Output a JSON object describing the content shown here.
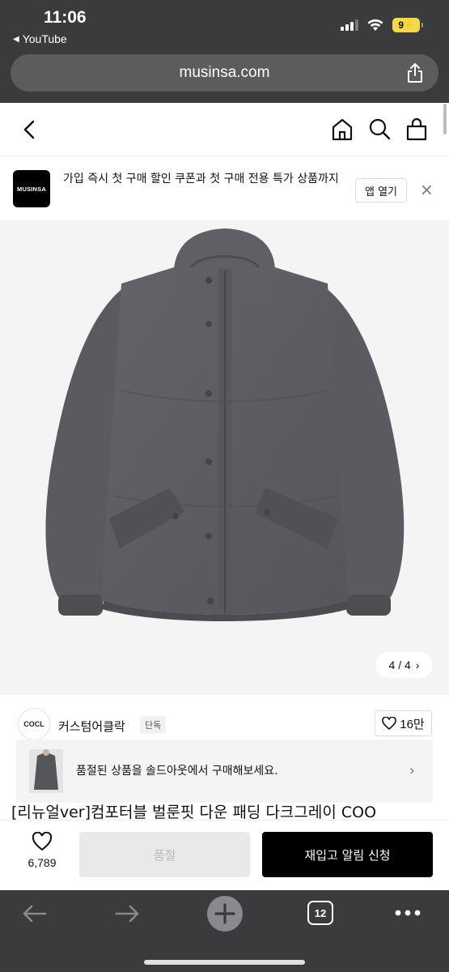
{
  "status_bar": {
    "time": "11:06",
    "back_app": "YouTube",
    "battery": "9"
  },
  "browser": {
    "url": "musinsa.com",
    "tab_count": "12"
  },
  "app_banner": {
    "logo_text": "MUSINSA",
    "text": "가입 즉시 첫 구매 할인 쿠폰과 첫 구매 전용 특가 상품까지",
    "open_label": "앱 열기",
    "close_label": "×"
  },
  "gallery": {
    "counter": "4 / 4",
    "next_label": "›"
  },
  "brand": {
    "logo_text": "COCL",
    "name": "커스텀어클락",
    "tag": "단독",
    "likes": "16만"
  },
  "promo": {
    "text": "품절된 상품을 솔드아웃에서 구매해보세요.",
    "arrow": "›"
  },
  "product": {
    "title": "[리뉴얼ver]컴포터블 벌룬핏 다운 패딩 다크그레이 COO"
  },
  "actions": {
    "fav_count": "6,789",
    "soldout_label": "품절",
    "restock_label": "재입고 알림 신청"
  },
  "colors": {
    "jacket": "#5b5c60",
    "safari_chrome": "#3b3b3d",
    "primary_button": "#000000"
  }
}
